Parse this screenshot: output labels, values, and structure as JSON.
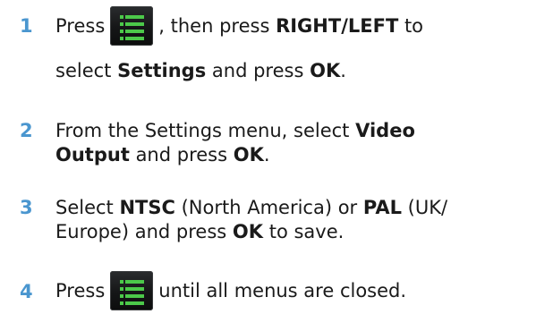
{
  "steps": [
    {
      "number": "1",
      "line1_pre": "Press",
      "line1_post": ", then press",
      "line1_bold": "RIGHT/LEFT",
      "line1_end": "to",
      "line2_pre": "select",
      "line2_bold": "Settings",
      "line2_mid": "and press",
      "line2_bold2": "OK",
      "line2_end": "."
    },
    {
      "number": "2",
      "line1_pre": "From the Settings menu, select",
      "line1_bold": "Video",
      "line2_bold": "Output",
      "line2_mid": "and press",
      "line2_bold2": "OK",
      "line2_end": "."
    },
    {
      "number": "3",
      "line1_pre": "Select",
      "line1_bold": "NTSC",
      "line1_mid": "(North America) or",
      "line1_bold2": "PAL",
      "line1_end": "(UK/",
      "line2_pre": "Europe) and press",
      "line2_bold": "OK",
      "line2_end": "to save."
    },
    {
      "number": "4",
      "line1_pre": "Press",
      "line1_post": "until all menus are closed."
    }
  ],
  "icons": {
    "menu": "menu-list-icon"
  },
  "colors": {
    "step_number": "#4a96cf",
    "icon_green": "#4cc94a",
    "icon_bg": "#151617"
  }
}
